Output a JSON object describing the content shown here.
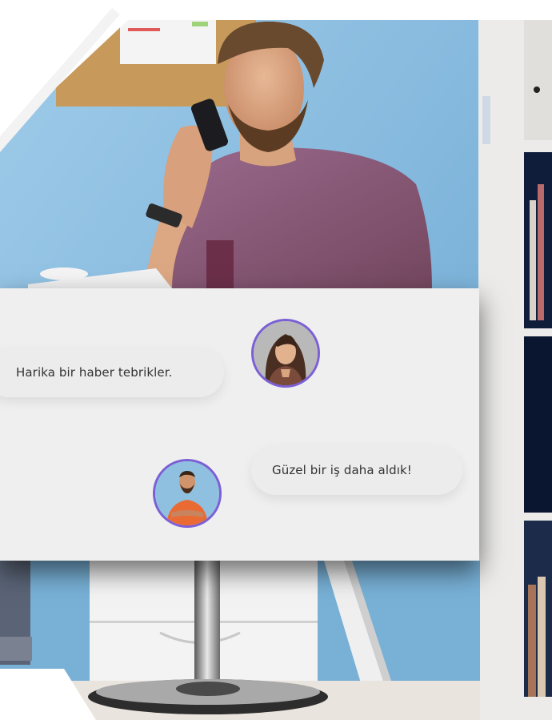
{
  "chat": {
    "messages": [
      {
        "text": "Harika bir haber tebrikler."
      },
      {
        "text": "Güzel bir iş daha aldık!"
      }
    ]
  },
  "colors": {
    "panel_bg": "#efefef",
    "bubble_bg": "#ececec",
    "avatar_ring": "#7b5fd6",
    "wall_blue": "#7ab3d9",
    "shirt": "#8a5a7c"
  }
}
